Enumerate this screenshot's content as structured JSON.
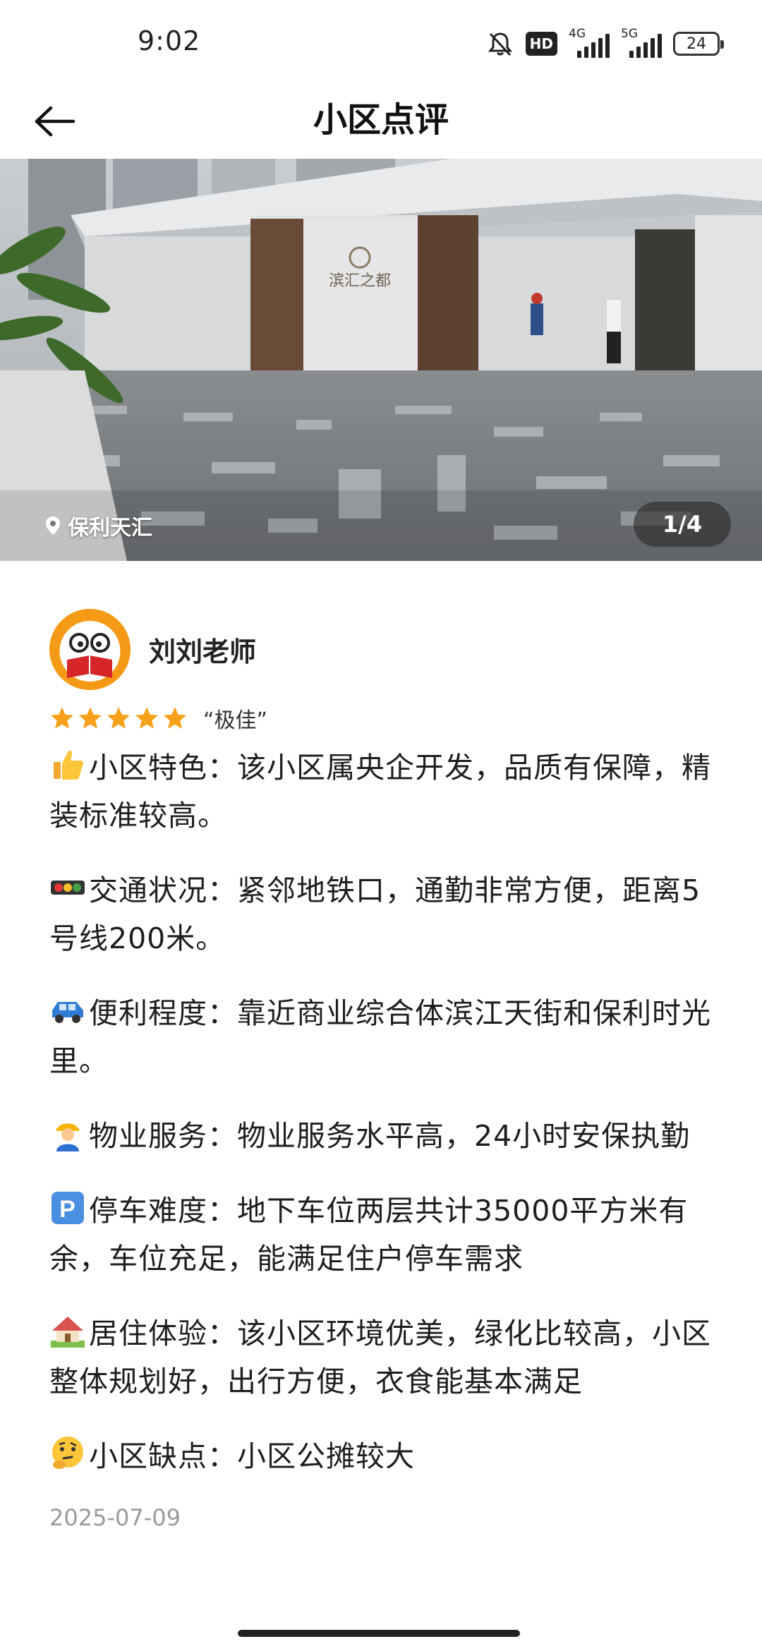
{
  "status_bar": {
    "time": "9:02",
    "hd_label": "HD",
    "net1_label": "4G",
    "net2_label": "5G",
    "battery": "24"
  },
  "header": {
    "title": "小区点评"
  },
  "photo": {
    "location": "保利天汇",
    "counter": "1/4",
    "sign_text": "滨汇之都"
  },
  "review": {
    "author": "刘刘老师",
    "rating_stars": 5,
    "rating_text": "“极佳”",
    "paragraphs": [
      {
        "icon": "thumbs-up-icon",
        "text": "小区特色：该小区属央企开发，品质有保障，精装标准较高。"
      },
      {
        "icon": "traffic-light-icon",
        "text": "交通状况：紧邻地铁口，通勤非常方便，距离5号线200米。"
      },
      {
        "icon": "car-icon",
        "text": "便利程度：靠近商业综合体滨江天街和保利时光里。"
      },
      {
        "icon": "worker-icon",
        "text": "物业服务：物业服务水平高，24小时安保执勤"
      },
      {
        "icon": "parking-icon",
        "text": "停车难度：地下车位两层共计35000平方米有余，车位充足，能满足住户停车需求"
      },
      {
        "icon": "house-icon",
        "text": "居住体验：该小区环境优美，绿化比较高，小区整体规划好，出行方便，衣食能基本满足"
      },
      {
        "icon": "thinking-face-icon",
        "text": "小区缺点：小区公摊较大"
      }
    ],
    "date": "2025-07-09"
  },
  "colors": {
    "avatar_bg": "#f59a16",
    "star": "#f7a11a",
    "date_text": "#9a9a9a"
  }
}
